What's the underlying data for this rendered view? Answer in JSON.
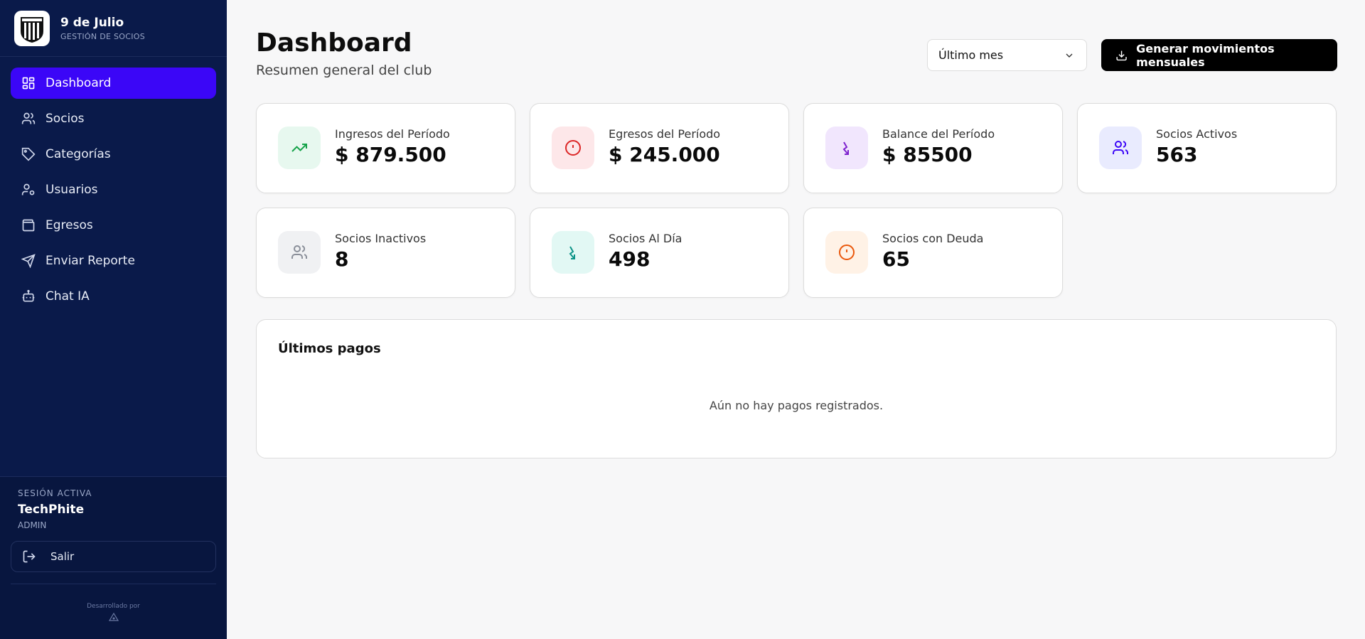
{
  "brand": {
    "name": "9 de Julio",
    "subtitle": "GESTIÓN DE SOCIOS"
  },
  "sidebar": {
    "items": [
      {
        "label": "Dashboard",
        "icon": "dashboard-icon",
        "active": true
      },
      {
        "label": "Socios",
        "icon": "users-icon"
      },
      {
        "label": "Categorías",
        "icon": "tag-icon"
      },
      {
        "label": "Usuarios",
        "icon": "user-cog-icon"
      },
      {
        "label": "Egresos",
        "icon": "wallet-icon"
      },
      {
        "label": "Enviar Reporte",
        "icon": "send-icon"
      },
      {
        "label": "Chat IA",
        "icon": "bot-icon"
      }
    ]
  },
  "session": {
    "label": "SESIÓN ACTIVA",
    "user": "TechPhite",
    "role": "ADMIN",
    "logout_label": "Salir"
  },
  "footer": {
    "developed_by": "Desarrollado por"
  },
  "header": {
    "title": "Dashboard",
    "subtitle": "Resumen general del club",
    "period_select": "Último mes",
    "generate_button": "Generar movimientos mensuales"
  },
  "stats": [
    {
      "label": "Ingresos del Período",
      "value": "$ 879.500",
      "icon": "trending-up-icon",
      "color": "#16a34a",
      "bg": "#e7f8ef"
    },
    {
      "label": "Egresos del Período",
      "value": "$ 245.000",
      "icon": "alert-circle-icon",
      "color": "#dc2626",
      "bg": "#fde7e9"
    },
    {
      "label": "Balance del Período",
      "value": "$ 85500",
      "icon": "arrow-down-right-icon",
      "color": "#7e22ce",
      "bg": "#f1e6fd"
    },
    {
      "label": "Socios Activos",
      "value": "563",
      "icon": "users-icon",
      "color": "#3b06f7",
      "bg": "#e9ebfe"
    },
    {
      "label": "Socios Inactivos",
      "value": "8",
      "icon": "users-icon",
      "color": "#8a8f99",
      "bg": "#f0f1f3"
    },
    {
      "label": "Socios Al Día",
      "value": "498",
      "icon": "arrow-down-right-icon",
      "color": "#0d9488",
      "bg": "#e2f8f4"
    },
    {
      "label": "Socios con Deuda",
      "value": "65",
      "icon": "alert-circle-icon",
      "color": "#ea580c",
      "bg": "#fff2e6"
    }
  ],
  "payments": {
    "title": "Últimos pagos",
    "empty_text": "Aún no hay pagos registrados."
  }
}
